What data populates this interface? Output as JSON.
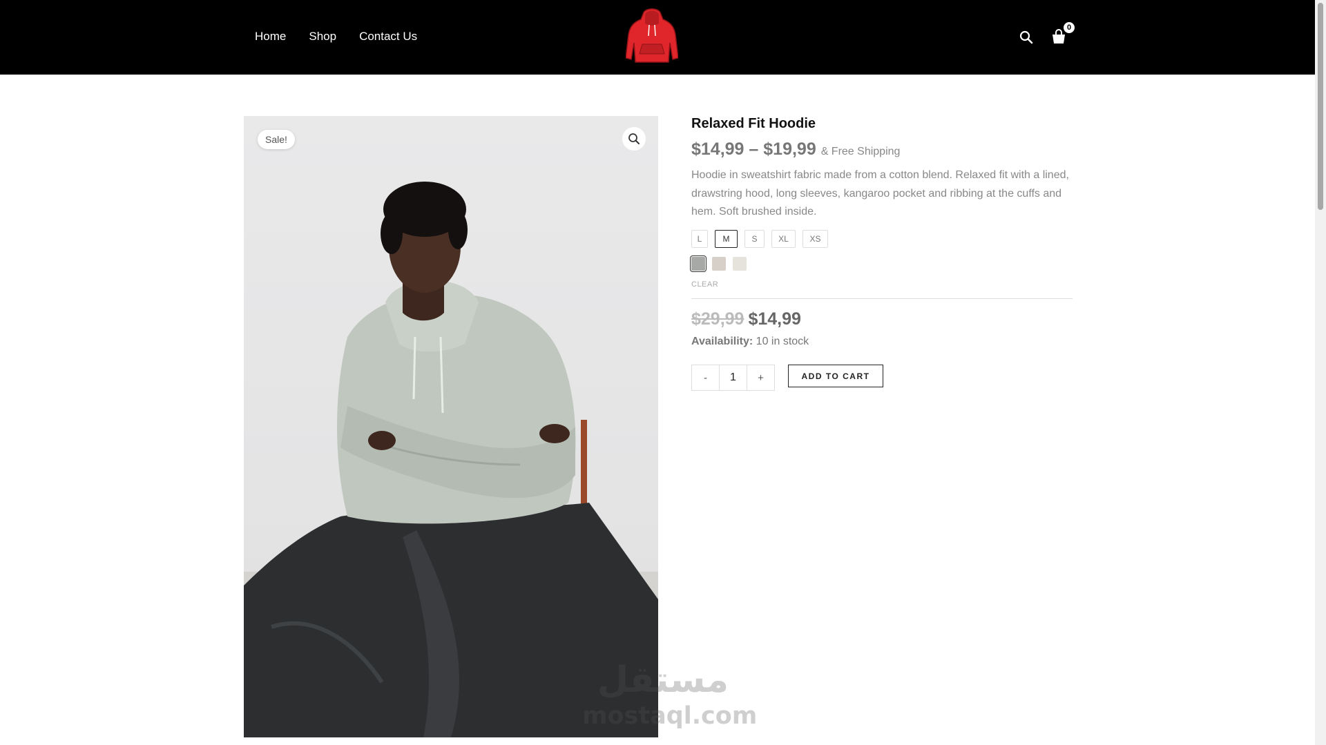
{
  "nav": {
    "items": [
      {
        "label": "Home"
      },
      {
        "label": "Shop"
      },
      {
        "label": "Contact Us"
      }
    ]
  },
  "header": {
    "logo_icon": "red-hoodie-logo",
    "search_icon": "search-icon",
    "cart_icon": "shopping-bag-icon",
    "cart_count": "0"
  },
  "product": {
    "badge": "Sale!",
    "title": "Relaxed Fit Hoodie",
    "price_min": "$14,99",
    "price_sep": " – ",
    "price_max": "$19,99",
    "shipping": "& Free Shipping",
    "description": "Hoodie in sweatshirt fabric made from a cotton blend. Relaxed fit with a lined, drawstring hood, long sleeves, kangaroo pocket and ribbing at the cuffs and hem. Soft brushed inside.",
    "sizes": [
      "L",
      "M",
      "S",
      "XL",
      "XS"
    ],
    "selected_size": "M",
    "colors": [
      "#a7a9a6",
      "#d6d0c8",
      "#e5e3dc"
    ],
    "selected_color_index": 0,
    "clear_label": "CLEAR",
    "old_price": "$29,99",
    "current_price": "$14,99",
    "availability_label": "Availability:",
    "availability_value": "10 in stock",
    "qty_minus": "-",
    "qty_value": "1",
    "qty_plus": "+",
    "add_to_cart": "ADD TO CART"
  },
  "watermark": {
    "arabic": "مستقل",
    "latin": "mostaql.com"
  }
}
